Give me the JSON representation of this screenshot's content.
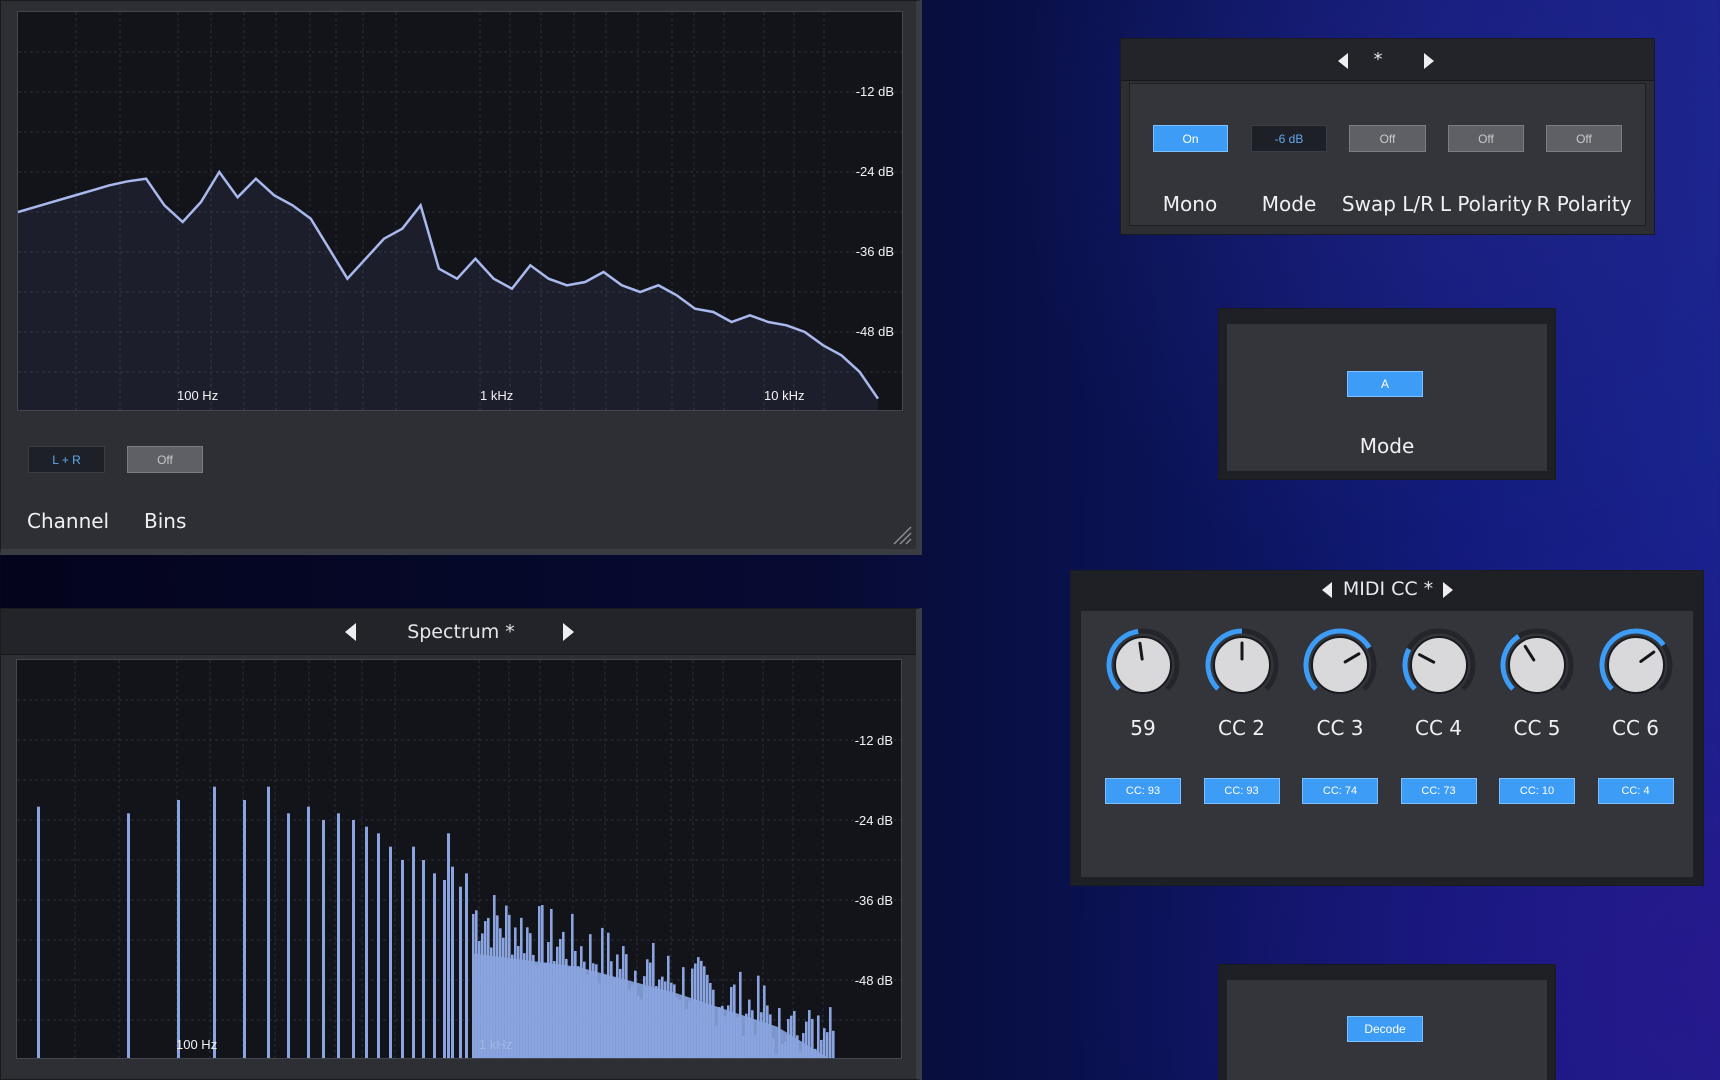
{
  "spectrum_top": {
    "db_labels": [
      "-12 dB",
      "-24 dB",
      "-36 dB",
      "-48 dB"
    ],
    "hz_labels": [
      "100 Hz",
      "1 kHz",
      "10 kHz"
    ],
    "curve_db": [
      -30.0,
      -29.2,
      -28.4,
      -27.6,
      -26.8,
      -26.0,
      -25.4,
      -25.0,
      -29.0,
      -31.5,
      -28.5,
      -24.0,
      -27.8,
      -25.0,
      -27.5,
      -29.0,
      -31.0,
      -35.5,
      -40.0,
      -37.0,
      -34.0,
      -32.5,
      -29.0,
      -38.5,
      -40.0,
      -37.0,
      -40.0,
      -41.5,
      -38.0,
      -40.0,
      -41.0,
      -40.5,
      -39.0,
      -41.0,
      -42.0,
      -41.0,
      -42.5,
      -44.5,
      -45.0,
      -46.5,
      -45.5,
      -46.5,
      -47.0,
      -48.0,
      -50.0,
      -51.5,
      -54.0,
      -58.0
    ],
    "channel_button": "L + R",
    "bins_button": "Off",
    "channel_label": "Channel",
    "bins_label": "Bins"
  },
  "spectrum_bottom": {
    "title": "Spectrum *",
    "db_labels": [
      "-12 dB",
      "-24 dB",
      "-36 dB",
      "-48 dB"
    ],
    "hz_labels": [
      "100 Hz",
      "1 kHz"
    ],
    "peak_bars_db": [
      -22,
      -23,
      -21,
      -19,
      -21,
      -19,
      -23,
      -22,
      -24,
      -23,
      -24,
      -25,
      -26,
      -28,
      -30,
      -28,
      -30,
      -32,
      -33,
      -31,
      -34,
      -32,
      -26
    ]
  },
  "utility": {
    "preset_name": "*",
    "buttons": [
      {
        "value": "On",
        "label": "Mono",
        "state": "on"
      },
      {
        "value": "-6 dB",
        "label": "Mode",
        "state": "dark"
      },
      {
        "value": "Off",
        "label": "Swap L/R",
        "state": "off"
      },
      {
        "value": "Off",
        "label": "L Polarity",
        "state": "off"
      },
      {
        "value": "Off",
        "label": "R Polarity",
        "state": "off"
      }
    ]
  },
  "mode_panel": {
    "button": "A",
    "label": "Mode"
  },
  "midi": {
    "title": "MIDI CC *",
    "knobs": [
      {
        "label": "59",
        "cc": "CC: 93",
        "value": 0.47
      },
      {
        "label": "CC 2",
        "cc": "CC: 93",
        "value": 0.5
      },
      {
        "label": "CC 3",
        "cc": "CC: 74",
        "value": 0.72
      },
      {
        "label": "CC 4",
        "cc": "CC: 73",
        "value": 0.27
      },
      {
        "label": "CC 5",
        "cc": "CC: 10",
        "value": 0.38
      },
      {
        "label": "CC 6",
        "cc": "CC: 4",
        "value": 0.7
      }
    ]
  },
  "decode_panel": {
    "button": "Decode"
  },
  "colors": {
    "accent": "#3d9cf5",
    "curve": "#a9b9ee",
    "bars": "#8aa4e0"
  }
}
